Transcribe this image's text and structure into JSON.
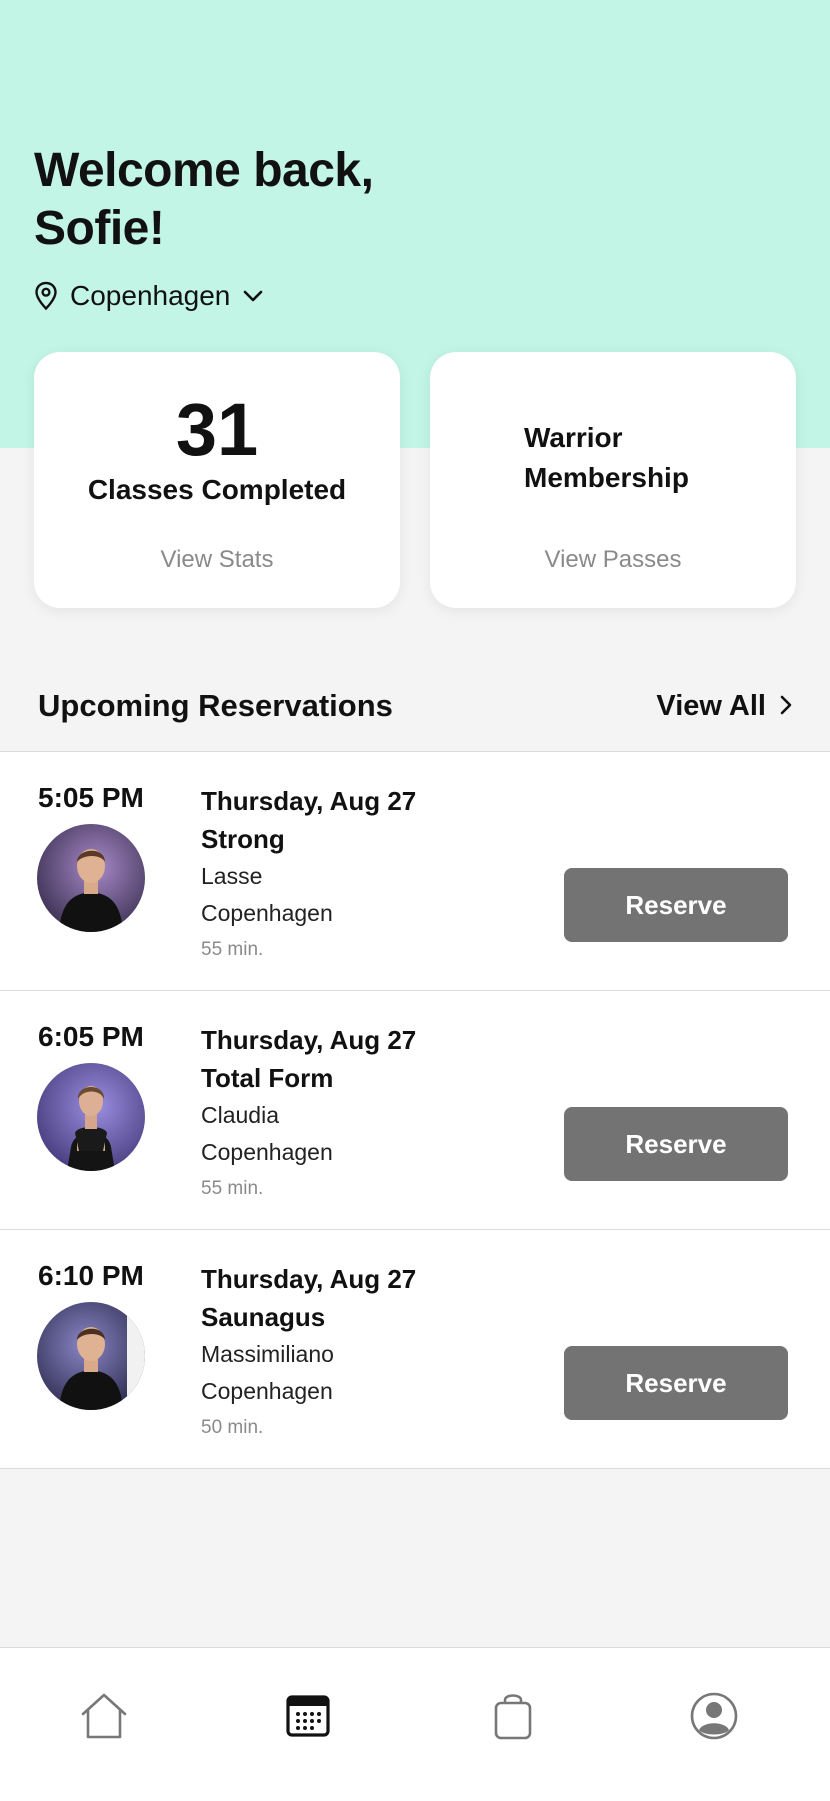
{
  "header": {
    "welcome_line1": "Welcome back,",
    "welcome_line2": "Sofie!",
    "location": "Copenhagen"
  },
  "stats_card": {
    "classes_completed_count": "31",
    "classes_completed_label": "Classes Completed",
    "link_label": "View Stats"
  },
  "membership_card": {
    "line1": "Warrior",
    "line2": "Membership",
    "link_label": "View Passes"
  },
  "reservations": {
    "title": "Upcoming Reservations",
    "view_all_label": "View All",
    "items": [
      {
        "time": "5:05 PM",
        "date": "Thursday, Aug 27",
        "class_name": "Strong",
        "instructor": "Lasse",
        "studio": "Copenhagen",
        "duration": "55 min.",
        "button_label": "Reserve"
      },
      {
        "time": "6:05 PM",
        "date": "Thursday, Aug 27",
        "class_name": "Total Form",
        "instructor": "Claudia",
        "studio": "Copenhagen",
        "duration": "55 min.",
        "button_label": "Reserve"
      },
      {
        "time": "6:10 PM",
        "date": "Thursday, Aug 27",
        "class_name": "Saunagus",
        "instructor": "Massimiliano",
        "studio": "Copenhagen",
        "duration": "50 min.",
        "button_label": "Reserve"
      }
    ]
  },
  "bottom_nav": {
    "items": [
      {
        "icon": "home-icon",
        "active": false
      },
      {
        "icon": "calendar-icon",
        "active": true
      },
      {
        "icon": "shopping-bag-icon",
        "active": false
      },
      {
        "icon": "profile-icon",
        "active": false
      }
    ]
  },
  "colors": {
    "hero_background": "#c2f5e6",
    "page_background": "#f4f4f5",
    "reserve_button": "#737373",
    "muted_text": "#8a8a8a"
  }
}
